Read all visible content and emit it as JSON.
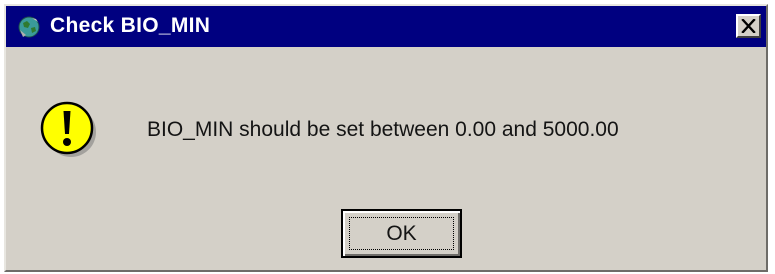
{
  "window": {
    "title": "Check BIO_MIN",
    "app_icon": "globe-app-icon",
    "close_icon": "close-x-icon",
    "titlebar_color": "#000080",
    "face_color": "#d4d0c8"
  },
  "dialog": {
    "icon": "warning-exclamation-icon",
    "icon_color": "#ffff00",
    "message": "BIO_MIN should be set between 0.00 and 5000.00",
    "ok_label": "OK"
  }
}
